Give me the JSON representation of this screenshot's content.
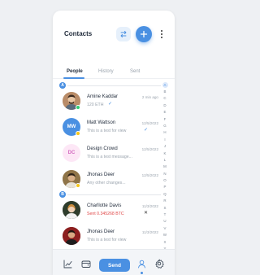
{
  "header": {
    "title": "Contacts"
  },
  "tabs": [
    {
      "label": "People",
      "active": true
    },
    {
      "label": "History",
      "active": false
    },
    {
      "label": "Sent",
      "active": false
    }
  ],
  "sections": [
    {
      "letter": "A",
      "contacts": [
        {
          "name": "Amine Kaddar",
          "subtitle": "120 ETH",
          "time": "2 min ago",
          "avatar": "photo",
          "status_color": "#2ecc71",
          "indicator": "check"
        },
        {
          "name": "Matt Wattson",
          "subtitle": "This is a test for view",
          "time": "12/5/2022",
          "avatar_initials": "MW",
          "avatar_color": "#4a90e2",
          "status_color": "#f5c518",
          "indicator": "check"
        },
        {
          "name": "Design Crowd",
          "subtitle": "This is a test message...",
          "time": "12/5/2022",
          "avatar_initials": "DC",
          "avatar_color": "#fde7f6"
        },
        {
          "name": "Jhonas Deer",
          "subtitle": "Any other changes...",
          "time": "12/5/2022",
          "avatar": "photo",
          "status_color": "#f5c518"
        }
      ]
    },
    {
      "letter": "B",
      "contacts": [
        {
          "name": "Charllotte Davis",
          "subtitle": "Sent 0.345268 BTC",
          "time": "11/3/2022",
          "avatar": "photo",
          "indicator": "close",
          "subtitle_red": true
        },
        {
          "name": "Jhonas Deer",
          "subtitle": "This is a test for view",
          "time": "11/3/2022",
          "avatar": "photo"
        }
      ]
    }
  ],
  "alphabet": [
    "A",
    "B",
    "C",
    "D",
    "E",
    "F",
    "G",
    "H",
    "I",
    "J",
    "K",
    "L",
    "M",
    "N",
    "O",
    "P",
    "Q",
    "R",
    "S",
    "T",
    "U",
    "V",
    "W",
    "X",
    "Y",
    "Z"
  ],
  "bottom_nav": {
    "send_label": "Send",
    "icons": [
      "chart-icon",
      "wallet-icon",
      "user-icon",
      "settings-icon"
    ]
  },
  "colors": {
    "accent": "#4a90e2",
    "background": "#eef0f3"
  }
}
